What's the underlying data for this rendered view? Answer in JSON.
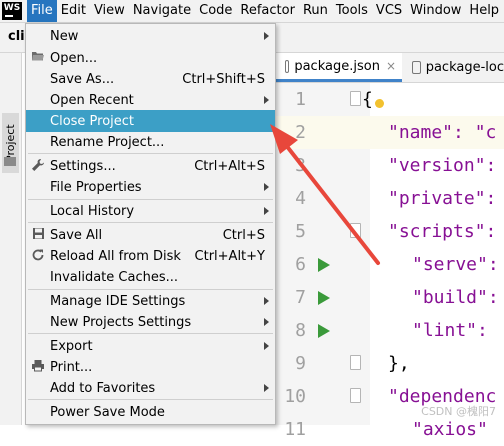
{
  "app": {
    "logo_text": "WS"
  },
  "menubar": [
    "File",
    "Edit",
    "View",
    "Navigate",
    "Code",
    "Refactor",
    "Run",
    "Tools",
    "VCS",
    "Window",
    "Help"
  ],
  "project": {
    "name": "cli",
    "sidebar_label": "Project"
  },
  "tabs": [
    {
      "label": "package.json",
      "close": "×"
    },
    {
      "label": "package-loc"
    }
  ],
  "editor": {
    "lines": [
      {
        "n": "1",
        "code": "{"
      },
      {
        "n": "2",
        "code": "\"name\": \"c"
      },
      {
        "n": "3",
        "code": "\"version\":"
      },
      {
        "n": "4",
        "code": "\"private\":"
      },
      {
        "n": "5",
        "code": "\"scripts\":"
      },
      {
        "n": "6",
        "code": "\"serve\":"
      },
      {
        "n": "7",
        "code": "\"build\":"
      },
      {
        "n": "8",
        "code": "\"lint\":"
      },
      {
        "n": "9",
        "code": "},"
      },
      {
        "n": "10",
        "code": "\"dependenc"
      },
      {
        "n": "11",
        "code": "\"axios\""
      }
    ]
  },
  "file_menu": {
    "items": [
      {
        "label": "New",
        "shortcut": "",
        "submenu": true,
        "icon": ""
      },
      {
        "label": "Open...",
        "shortcut": "",
        "submenu": false,
        "icon": "folder-open-icon"
      },
      {
        "label": "Save As...",
        "shortcut": "Ctrl+Shift+S",
        "submenu": false,
        "icon": ""
      },
      {
        "label": "Open Recent",
        "shortcut": "",
        "submenu": true,
        "icon": ""
      },
      {
        "label": "Close Project",
        "shortcut": "",
        "submenu": false,
        "icon": "",
        "selected": true
      },
      {
        "label": "Rename Project...",
        "shortcut": "",
        "submenu": false,
        "icon": ""
      },
      {
        "label": "Settings...",
        "shortcut": "Ctrl+Alt+S",
        "submenu": false,
        "icon": "wrench-icon"
      },
      {
        "label": "File Properties",
        "shortcut": "",
        "submenu": true,
        "icon": ""
      },
      {
        "label": "Local History",
        "shortcut": "",
        "submenu": true,
        "icon": ""
      },
      {
        "label": "Save All",
        "shortcut": "Ctrl+S",
        "submenu": false,
        "icon": "save-icon"
      },
      {
        "label": "Reload All from Disk",
        "shortcut": "Ctrl+Alt+Y",
        "submenu": false,
        "icon": "reload-icon"
      },
      {
        "label": "Invalidate Caches...",
        "shortcut": "",
        "submenu": false,
        "icon": ""
      },
      {
        "label": "Manage IDE Settings",
        "shortcut": "",
        "submenu": true,
        "icon": ""
      },
      {
        "label": "New Projects Settings",
        "shortcut": "",
        "submenu": true,
        "icon": ""
      },
      {
        "label": "Export",
        "shortcut": "",
        "submenu": true,
        "icon": ""
      },
      {
        "label": "Print...",
        "shortcut": "",
        "submenu": false,
        "icon": "print-icon"
      },
      {
        "label": "Add to Favorites",
        "shortcut": "",
        "submenu": true,
        "icon": ""
      },
      {
        "label": "Power Save Mode",
        "shortcut": "",
        "submenu": false,
        "icon": ""
      }
    ]
  },
  "watermark": "CSDN @槐阳7",
  "colors": {
    "selected_bg": "#3c9fc6",
    "menubar_active": "#2675bf",
    "annotation_arrow": "#e8473b",
    "json_key": "#871094",
    "run_icon": "#3a9a3a"
  }
}
